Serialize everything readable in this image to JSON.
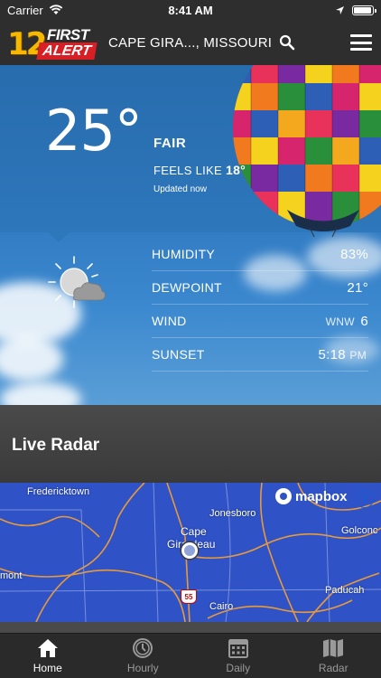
{
  "status_bar": {
    "carrier": "Carrier",
    "time": "8:41 AM",
    "battery_level": 0.86
  },
  "header": {
    "logo": {
      "number": "12",
      "line1": "FIRST",
      "line2": "ALERT"
    },
    "location": "CAPE GIRA..., MISSOURI"
  },
  "current": {
    "temperature": "25°",
    "condition": "FAIR",
    "feels_like_label": "FEELS LIKE",
    "feels_like_value": "18°",
    "updated": "Updated now",
    "icon": "partly-cloudy-sun-icon"
  },
  "details": [
    {
      "label": "HUMIDITY",
      "value": "83%",
      "unit": ""
    },
    {
      "label": "DEWPOINT",
      "value": "21°",
      "unit": ""
    },
    {
      "label": "WIND",
      "value": "6",
      "unit": "WNW"
    },
    {
      "label": "SUNSET",
      "value": "5:18",
      "unit": "PM"
    }
  ],
  "radar": {
    "title": "Live Radar",
    "attribution": "mapbox",
    "info_icon": "i",
    "labels": {
      "fredericktown": "Fredericktown",
      "jonesboro": "Jonesboro",
      "cape": "Cape",
      "girardeau": "Girardeau",
      "golconda": "Golconc",
      "mont": "mont",
      "paducah": "Paducah",
      "cairo": "Cairo"
    },
    "highway_shield": "55"
  },
  "tabs": [
    {
      "label": "Home",
      "icon": "home-icon",
      "active": true
    },
    {
      "label": "Hourly",
      "icon": "clock-icon",
      "active": false
    },
    {
      "label": "Daily",
      "icon": "calendar-icon",
      "active": false
    },
    {
      "label": "Radar",
      "icon": "map-icon",
      "active": false
    }
  ],
  "colors": {
    "logo_yellow": "#f6b800",
    "logo_red": "#d81f26",
    "sky_blue": "#2f78bf",
    "radar_blue": "#2f52c6"
  }
}
